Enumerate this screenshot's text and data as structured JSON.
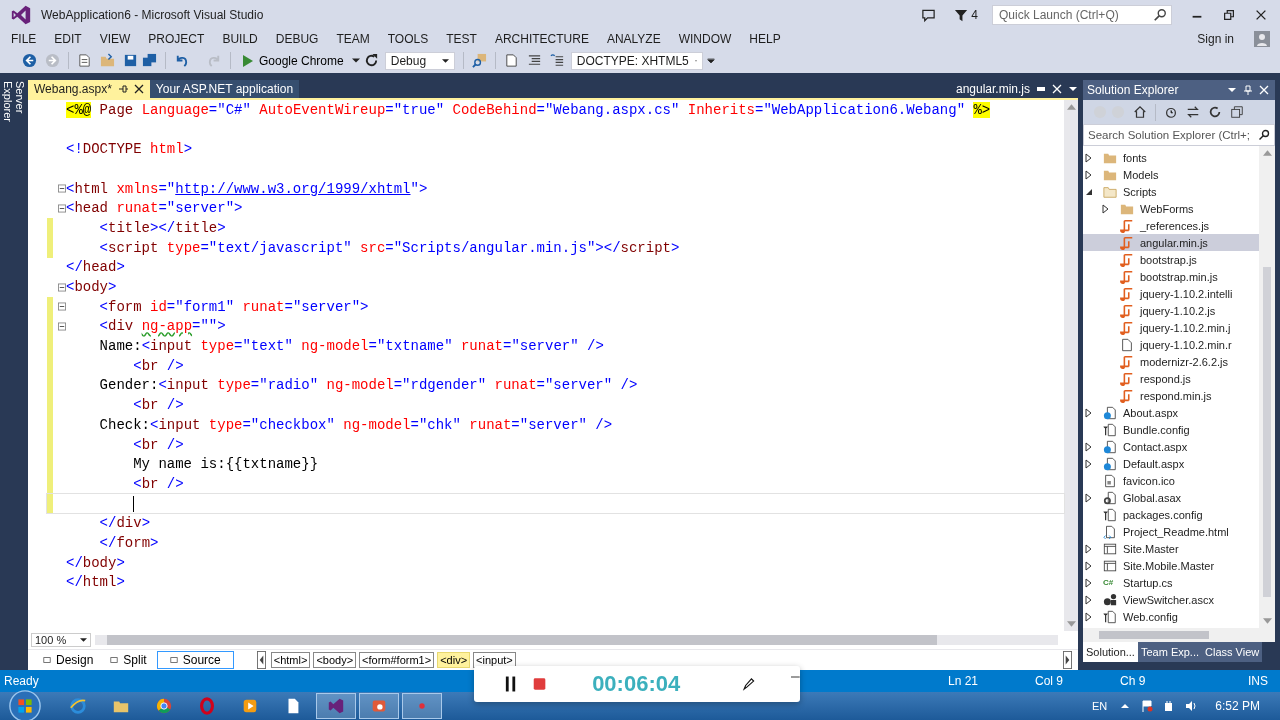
{
  "window": {
    "title": "WebApplication6 - Microsoft Visual Studio",
    "notification_count": "4",
    "quick_launch": {
      "placeholder": "Quick Launch (Ctrl+Q)"
    }
  },
  "menu": [
    "FILE",
    "EDIT",
    "VIEW",
    "PROJECT",
    "BUILD",
    "DEBUG",
    "TEAM",
    "TOOLS",
    "TEST",
    "ARCHITECTURE",
    "ANALYZE",
    "WINDOW",
    "HELP"
  ],
  "account": {
    "label": "Sign in"
  },
  "toolbar": {
    "run_target": "Google Chrome",
    "configuration": "Debug",
    "doctype": "DOCTYPE: XHTML5"
  },
  "side_strip": {
    "label": "Server Explorer"
  },
  "document_tabs": [
    {
      "label": "Webang.aspx*",
      "selected": true
    },
    {
      "label": "Your ASP.NET application",
      "selected": false
    }
  ],
  "preview_tab": {
    "label": "angular.min.js"
  },
  "editor": {
    "lines": [
      {
        "changed": false,
        "fold": false,
        "tokens": [
          {
            "kind": "directive",
            "text": "<%@"
          },
          {
            "kind": "tag",
            "text": " Page"
          },
          {
            "kind": "attr",
            "text": " Language"
          },
          {
            "kind": "delim",
            "text": "="
          },
          {
            "kind": "value",
            "text": "\"C#\""
          },
          {
            "kind": "attr",
            "text": " AutoEventWireup"
          },
          {
            "kind": "delim",
            "text": "="
          },
          {
            "kind": "value",
            "text": "\"true\""
          },
          {
            "kind": "attr",
            "text": " CodeBehind"
          },
          {
            "kind": "delim",
            "text": "="
          },
          {
            "kind": "value",
            "text": "\"Webang.aspx.cs\""
          },
          {
            "kind": "attr",
            "text": " Inherits"
          },
          {
            "kind": "delim",
            "text": "="
          },
          {
            "kind": "value",
            "text": "\"WebApplication6.Webang\" "
          },
          {
            "kind": "directive",
            "text": "%>"
          }
        ]
      },
      {
        "changed": false,
        "fold": false
      },
      {
        "changed": false,
        "fold": false,
        "tokens": [
          {
            "kind": "delim",
            "text": "<!"
          },
          {
            "kind": "tag",
            "text": "DOCTYPE"
          },
          {
            "kind": "attr",
            "text": " html"
          },
          {
            "kind": "delim",
            "text": ">"
          }
        ]
      },
      {
        "changed": false,
        "fold": false
      },
      {
        "changed": false,
        "fold": true,
        "tokens": [
          {
            "kind": "delim",
            "text": "<"
          },
          {
            "kind": "tag",
            "text": "html"
          },
          {
            "kind": "attr",
            "text": " xmlns"
          },
          {
            "kind": "delim",
            "text": "="
          },
          {
            "kind": "value",
            "text": "\""
          },
          {
            "kind": "link",
            "text": "http://www.w3.org/1999/xhtml"
          },
          {
            "kind": "value",
            "text": "\""
          },
          {
            "kind": "delim",
            "text": ">"
          }
        ]
      },
      {
        "changed": false,
        "fold": true,
        "tokens": [
          {
            "kind": "delim",
            "text": "<"
          },
          {
            "kind": "tag",
            "text": "head"
          },
          {
            "kind": "attr",
            "text": " runat"
          },
          {
            "kind": "delim",
            "text": "="
          },
          {
            "kind": "value",
            "text": "\"server\""
          },
          {
            "kind": "delim",
            "text": ">"
          }
        ]
      },
      {
        "changed": true,
        "fold": false,
        "tokens": [
          {
            "kind": "delim",
            "text": "    <"
          },
          {
            "kind": "tag",
            "text": "title"
          },
          {
            "kind": "delim",
            "text": "></"
          },
          {
            "kind": "tag",
            "text": "title"
          },
          {
            "kind": "delim",
            "text": ">"
          }
        ]
      },
      {
        "changed": true,
        "fold": false,
        "tokens": [
          {
            "kind": "delim",
            "text": "    <"
          },
          {
            "kind": "tag",
            "text": "script"
          },
          {
            "kind": "attr",
            "text": " type"
          },
          {
            "kind": "delim",
            "text": "="
          },
          {
            "kind": "value",
            "text": "\"text/javascript\""
          },
          {
            "kind": "attr",
            "text": " src"
          },
          {
            "kind": "delim",
            "text": "="
          },
          {
            "kind": "value",
            "text": "\"Scripts/angular.min.js\""
          },
          {
            "kind": "delim",
            "text": "></"
          },
          {
            "kind": "tag",
            "text": "script"
          },
          {
            "kind": "delim",
            "text": ">"
          }
        ]
      },
      {
        "changed": false,
        "fold": false,
        "tokens": [
          {
            "kind": "delim",
            "text": "</"
          },
          {
            "kind": "tag",
            "text": "head"
          },
          {
            "kind": "delim",
            "text": ">"
          }
        ]
      },
      {
        "changed": false,
        "fold": true,
        "tokens": [
          {
            "kind": "delim",
            "text": "<"
          },
          {
            "kind": "tag",
            "text": "body"
          },
          {
            "kind": "delim",
            "text": ">"
          }
        ]
      },
      {
        "changed": true,
        "fold": true,
        "tokens": [
          {
            "kind": "delim",
            "text": "    <"
          },
          {
            "kind": "tag",
            "text": "form"
          },
          {
            "kind": "attr",
            "text": " id"
          },
          {
            "kind": "delim",
            "text": "="
          },
          {
            "kind": "value",
            "text": "\"form1\""
          },
          {
            "kind": "attr",
            "text": " runat"
          },
          {
            "kind": "delim",
            "text": "="
          },
          {
            "kind": "value",
            "text": "\"server\""
          },
          {
            "kind": "delim",
            "text": ">"
          }
        ]
      },
      {
        "changed": true,
        "fold": true,
        "tokens": [
          {
            "kind": "delim",
            "text": "    <"
          },
          {
            "kind": "tag",
            "text": "div "
          },
          {
            "kind": "attr",
            "text": "ng-app",
            "squiggle": true
          },
          {
            "kind": "delim",
            "text": "="
          },
          {
            "kind": "value",
            "text": "\"\""
          },
          {
            "kind": "delim",
            "text": ">"
          }
        ]
      },
      {
        "changed": true,
        "fold": false,
        "tokens": [
          {
            "kind": "text",
            "text": "    Name:"
          },
          {
            "kind": "delim",
            "text": "<"
          },
          {
            "kind": "tag",
            "text": "input"
          },
          {
            "kind": "attr",
            "text": " type"
          },
          {
            "kind": "delim",
            "text": "="
          },
          {
            "kind": "value",
            "text": "\"text\""
          },
          {
            "kind": "attr",
            "text": " ng-model"
          },
          {
            "kind": "delim",
            "text": "="
          },
          {
            "kind": "value",
            "text": "\"txtname\""
          },
          {
            "kind": "attr",
            "text": " runat"
          },
          {
            "kind": "delim",
            "text": "="
          },
          {
            "kind": "value",
            "text": "\"server\""
          },
          {
            "kind": "delim",
            "text": " />"
          }
        ]
      },
      {
        "changed": true,
        "fold": false,
        "tokens": [
          {
            "kind": "delim",
            "text": "        <"
          },
          {
            "kind": "tag",
            "text": "br"
          },
          {
            "kind": "delim",
            "text": " />"
          }
        ]
      },
      {
        "changed": true,
        "fold": false,
        "tokens": [
          {
            "kind": "text",
            "text": "    Gender:"
          },
          {
            "kind": "delim",
            "text": "<"
          },
          {
            "kind": "tag",
            "text": "input"
          },
          {
            "kind": "attr",
            "text": " type"
          },
          {
            "kind": "delim",
            "text": "="
          },
          {
            "kind": "value",
            "text": "\"radio\""
          },
          {
            "kind": "attr",
            "text": " ng-model"
          },
          {
            "kind": "delim",
            "text": "="
          },
          {
            "kind": "value",
            "text": "\"rdgender\""
          },
          {
            "kind": "attr",
            "text": " runat"
          },
          {
            "kind": "delim",
            "text": "="
          },
          {
            "kind": "value",
            "text": "\"server\""
          },
          {
            "kind": "delim",
            "text": " />"
          }
        ]
      },
      {
        "changed": true,
        "fold": false,
        "tokens": [
          {
            "kind": "delim",
            "text": "        <"
          },
          {
            "kind": "tag",
            "text": "br"
          },
          {
            "kind": "delim",
            "text": " />"
          }
        ]
      },
      {
        "changed": true,
        "fold": false,
        "tokens": [
          {
            "kind": "text",
            "text": "    Check:"
          },
          {
            "kind": "delim",
            "text": "<"
          },
          {
            "kind": "tag",
            "text": "input"
          },
          {
            "kind": "attr",
            "text": " type"
          },
          {
            "kind": "delim",
            "text": "="
          },
          {
            "kind": "value",
            "text": "\"checkbox\""
          },
          {
            "kind": "attr",
            "text": " ng-model"
          },
          {
            "kind": "delim",
            "text": "="
          },
          {
            "kind": "value",
            "text": "\"chk\""
          },
          {
            "kind": "attr",
            "text": " runat"
          },
          {
            "kind": "delim",
            "text": "="
          },
          {
            "kind": "value",
            "text": "\"server\""
          },
          {
            "kind": "delim",
            "text": " />"
          }
        ]
      },
      {
        "changed": true,
        "fold": false,
        "tokens": [
          {
            "kind": "delim",
            "text": "        <"
          },
          {
            "kind": "tag",
            "text": "br"
          },
          {
            "kind": "delim",
            "text": " />"
          }
        ]
      },
      {
        "changed": true,
        "fold": false,
        "tokens": [
          {
            "kind": "text",
            "text": "        My name is:{{txtname}}"
          }
        ]
      },
      {
        "changed": true,
        "fold": false,
        "tokens": [
          {
            "kind": "delim",
            "text": "        <"
          },
          {
            "kind": "tag",
            "text": "br"
          },
          {
            "kind": "delim",
            "text": " />"
          }
        ]
      },
      {
        "changed": true,
        "fold": false,
        "current": true
      },
      {
        "changed": false,
        "fold": false,
        "tokens": [
          {
            "kind": "delim",
            "text": "    </"
          },
          {
            "kind": "tag",
            "text": "div"
          },
          {
            "kind": "delim",
            "text": ">"
          }
        ]
      },
      {
        "changed": false,
        "fold": false,
        "tokens": [
          {
            "kind": "delim",
            "text": "    </"
          },
          {
            "kind": "tag",
            "text": "form"
          },
          {
            "kind": "delim",
            "text": ">"
          }
        ]
      },
      {
        "changed": false,
        "fold": false,
        "tokens": [
          {
            "kind": "delim",
            "text": "</"
          },
          {
            "kind": "tag",
            "text": "body"
          },
          {
            "kind": "delim",
            "text": ">"
          }
        ]
      },
      {
        "changed": false,
        "fold": false,
        "tokens": [
          {
            "kind": "delim",
            "text": "</"
          },
          {
            "kind": "tag",
            "text": "html"
          },
          {
            "kind": "delim",
            "text": ">"
          }
        ]
      }
    ],
    "zoom": "100 %",
    "views": [
      {
        "label": "Design",
        "selected": false
      },
      {
        "label": "Split",
        "selected": false
      },
      {
        "label": "Source",
        "selected": true
      }
    ],
    "breadcrumb": [
      {
        "label": "<html>",
        "selected": false
      },
      {
        "label": "<body>",
        "selected": false
      },
      {
        "label": "<form#form1>",
        "selected": false
      },
      {
        "label": "<div>",
        "selected": true
      },
      {
        "label": "<input>",
        "selected": false
      }
    ]
  },
  "solution_explorer": {
    "title": "Solution Explorer",
    "search": {
      "placeholder": "Search Solution Explorer (Ctrl+;"
    },
    "items": [
      {
        "label": "fonts",
        "kind": "folder",
        "expanded": false,
        "selected": false
      },
      {
        "label": "Models",
        "kind": "folder",
        "expanded": false,
        "selected": false
      },
      {
        "label": "Scripts",
        "kind": "folder-open",
        "expanded": true,
        "selected": false,
        "children": [
          {
            "label": "WebForms",
            "kind": "folder",
            "expanded": false,
            "selected": false
          },
          {
            "label": "_references.js",
            "kind": "script",
            "selected": false
          },
          {
            "label": "angular.min.js",
            "kind": "script",
            "selected": true
          },
          {
            "label": "bootstrap.js",
            "kind": "script",
            "selected": false
          },
          {
            "label": "bootstrap.min.js",
            "kind": "script",
            "selected": false
          },
          {
            "label": "jquery-1.10.2.intelli",
            "kind": "script",
            "selected": false
          },
          {
            "label": "jquery-1.10.2.js",
            "kind": "script",
            "selected": false
          },
          {
            "label": "jquery-1.10.2.min.j",
            "kind": "script",
            "selected": false
          },
          {
            "label": "jquery-1.10.2.min.r",
            "kind": "file",
            "selected": false
          },
          {
            "label": "modernizr-2.6.2.js",
            "kind": "script",
            "selected": false
          },
          {
            "label": "respond.js",
            "kind": "script",
            "selected": false
          },
          {
            "label": "respond.min.js",
            "kind": "script",
            "selected": false
          }
        ]
      },
      {
        "label": "About.aspx",
        "kind": "web",
        "expanded": false,
        "selected": false
      },
      {
        "label": "Bundle.config",
        "kind": "config",
        "selected": false
      },
      {
        "label": "Contact.aspx",
        "kind": "web",
        "expanded": false,
        "selected": false
      },
      {
        "label": "Default.aspx",
        "kind": "web",
        "expanded": false,
        "selected": false
      },
      {
        "label": "favicon.ico",
        "kind": "image",
        "selected": false
      },
      {
        "label": "Global.asax",
        "kind": "gear",
        "expanded": false,
        "selected": false
      },
      {
        "label": "packages.config",
        "kind": "config",
        "selected": false
      },
      {
        "label": "Project_Readme.html",
        "kind": "html",
        "selected": false
      },
      {
        "label": "Site.Master",
        "kind": "master",
        "expanded": false,
        "selected": false
      },
      {
        "label": "Site.Mobile.Master",
        "kind": "master",
        "expanded": false,
        "selected": false
      },
      {
        "label": "Startup.cs",
        "kind": "csharp",
        "badge": "C#",
        "expanded": false,
        "selected": false
      },
      {
        "label": "ViewSwitcher.ascx",
        "kind": "control",
        "expanded": false,
        "selected": false
      },
      {
        "label": "Web.config",
        "kind": "config",
        "expanded": false,
        "selected": false
      }
    ],
    "tabs": [
      {
        "label": "Solution...",
        "selected": true
      },
      {
        "label": "Team Exp...",
        "selected": false
      },
      {
        "label": "Class View",
        "selected": false
      }
    ]
  },
  "status_bar": {
    "state": "Ready",
    "line": "Ln 21",
    "column": "Col 9",
    "char": "Ch 9",
    "mode": "INS"
  },
  "recorder": {
    "elapsed": "00:06:04"
  },
  "taskbar": {
    "apps": [
      {
        "kind": "e-browser",
        "running": false
      },
      {
        "kind": "folder",
        "running": false
      },
      {
        "kind": "wheel-browser",
        "running": false
      },
      {
        "kind": "ring-browser",
        "running": false
      },
      {
        "kind": "player",
        "running": false
      },
      {
        "kind": "document",
        "running": false
      },
      {
        "kind": "studio",
        "running": true
      },
      {
        "kind": "presenter",
        "running": true
      },
      {
        "kind": "recorder",
        "running": true
      }
    ],
    "language": "EN",
    "clock": "6:52 PM"
  }
}
